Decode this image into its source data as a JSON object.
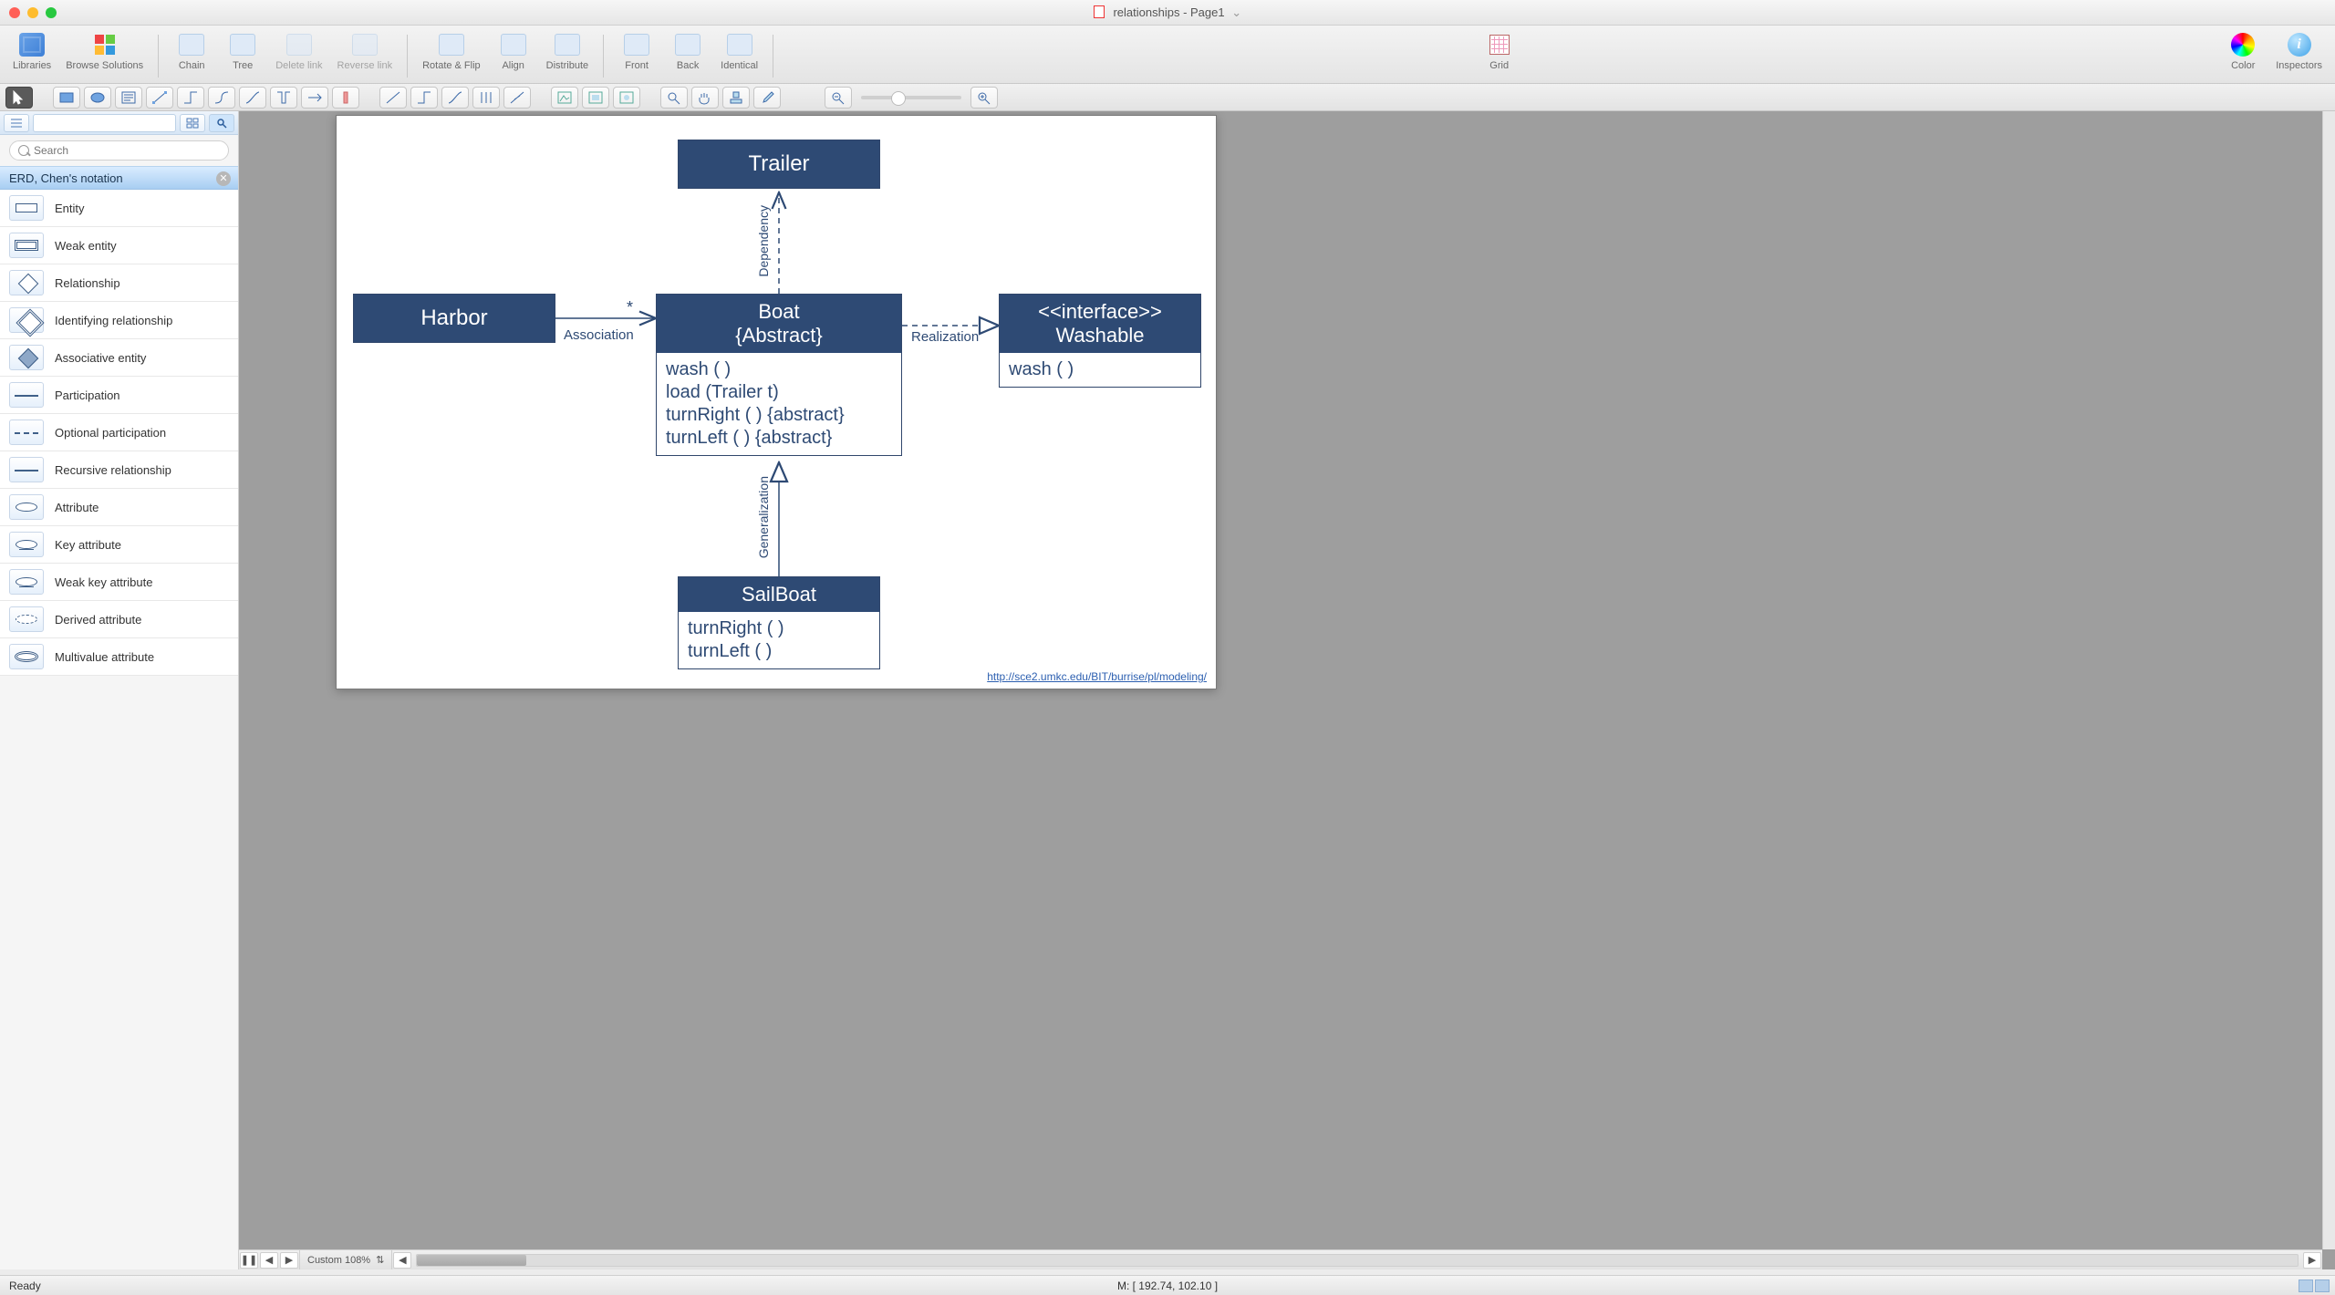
{
  "window": {
    "title": "relationships - Page1"
  },
  "toolbar": {
    "libraries": "Libraries",
    "browse": "Browse Solutions",
    "chain": "Chain",
    "tree": "Tree",
    "delete_link": "Delete link",
    "reverse_link": "Reverse link",
    "rotate_flip": "Rotate & Flip",
    "align": "Align",
    "distribute": "Distribute",
    "front": "Front",
    "back": "Back",
    "identical": "Identical",
    "grid": "Grid",
    "color": "Color",
    "inspectors": "Inspectors"
  },
  "sidebar": {
    "search_placeholder": "Search",
    "section": "ERD, Chen's notation",
    "items": [
      "Entity",
      "Weak entity",
      "Relationship",
      "Identifying relationship",
      "Associative entity",
      "Participation",
      "Optional participation",
      "Recursive relationship",
      "Attribute",
      "Key attribute",
      "Weak key attribute",
      "Derived attribute",
      "Multivalue attribute"
    ]
  },
  "diagram": {
    "trailer": "Trailer",
    "harbor": "Harbor",
    "boat_title": "Boat",
    "boat_sub": "{Abstract}",
    "boat_ops": [
      "wash ( )",
      "load (Trailer t)",
      "turnRight ( ) {abstract}",
      "turnLeft ( ) {abstract}"
    ],
    "washable_stereo": "<<interface>>",
    "washable_name": "Washable",
    "washable_ops": [
      "wash ( )"
    ],
    "sailboat": "SailBoat",
    "sailboat_ops": [
      "turnRight ( )",
      "turnLeft ( )"
    ],
    "assoc": "Association",
    "assoc_mult": "*",
    "dependency": "Dependency",
    "generalization": "Generalization",
    "realization": "Realization",
    "footer_link": "http://sce2.umkc.edu/BIT/burrise/pl/modeling/"
  },
  "bottom": {
    "zoom_label": "Custom 108%"
  },
  "status": {
    "left": "Ready",
    "mouse": "M: [ 192.74, 102.10 ]"
  }
}
